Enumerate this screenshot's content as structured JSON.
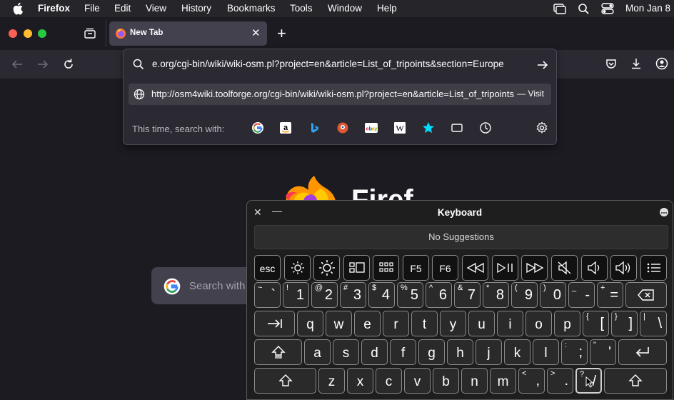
{
  "menubar": {
    "app": "Firefox",
    "items": [
      "File",
      "Edit",
      "View",
      "History",
      "Bookmarks",
      "Tools",
      "Window",
      "Help"
    ],
    "datetime": "Mon Jan 8"
  },
  "tab": {
    "title": "New Tab"
  },
  "urlbar": {
    "value": "e.org/cgi-bin/wiki/wiki-osm.pl?project=en&article=List_of_tripoints&section=Europe",
    "result_url": "http://osm4wiki.toolforge.org/cgi-bin/wiki/wiki-osm.pl?project=en&article=List_of_tripoints&section=Europe",
    "result_action": "— Visit",
    "search_with_label": "This time, search with:",
    "engines": [
      "google",
      "amazon",
      "bing",
      "duckduckgo",
      "ebay",
      "wikipedia",
      "bookmarks",
      "tabs",
      "history"
    ]
  },
  "newtab": {
    "brand": "Firef",
    "search_placeholder": "Search with"
  },
  "keyboard": {
    "title": "Keyboard",
    "suggestions": "No Suggestions",
    "fn_row": [
      "esc",
      "F5",
      "F6"
    ],
    "num_row": [
      [
        "~",
        "`"
      ],
      [
        "!",
        "1"
      ],
      [
        "@",
        "2"
      ],
      [
        "#",
        "3"
      ],
      [
        "$",
        "4"
      ],
      [
        "%",
        "5"
      ],
      [
        "^",
        "6"
      ],
      [
        "&",
        "7"
      ],
      [
        "*",
        "8"
      ],
      [
        "(",
        "9"
      ],
      [
        ")",
        "0"
      ],
      [
        "_",
        "-"
      ],
      [
        "+",
        "="
      ]
    ],
    "row_q": [
      "q",
      "w",
      "e",
      "r",
      "t",
      "y",
      "u",
      "i",
      "o",
      "p"
    ],
    "row_q_sym": [
      [
        "{",
        "["
      ],
      [
        "}",
        "]"
      ],
      [
        "|",
        "\\"
      ]
    ],
    "row_a": [
      "a",
      "s",
      "d",
      "f",
      "g",
      "h",
      "j",
      "k",
      "l"
    ],
    "row_a_sym": [
      [
        ":",
        ";"
      ],
      [
        "\"",
        "'"
      ]
    ],
    "row_z": [
      "z",
      "x",
      "c",
      "v",
      "b",
      "n",
      "m"
    ],
    "row_z_sym": [
      [
        "<",
        ","
      ],
      [
        ">",
        "."
      ],
      [
        "?",
        "/"
      ]
    ]
  }
}
